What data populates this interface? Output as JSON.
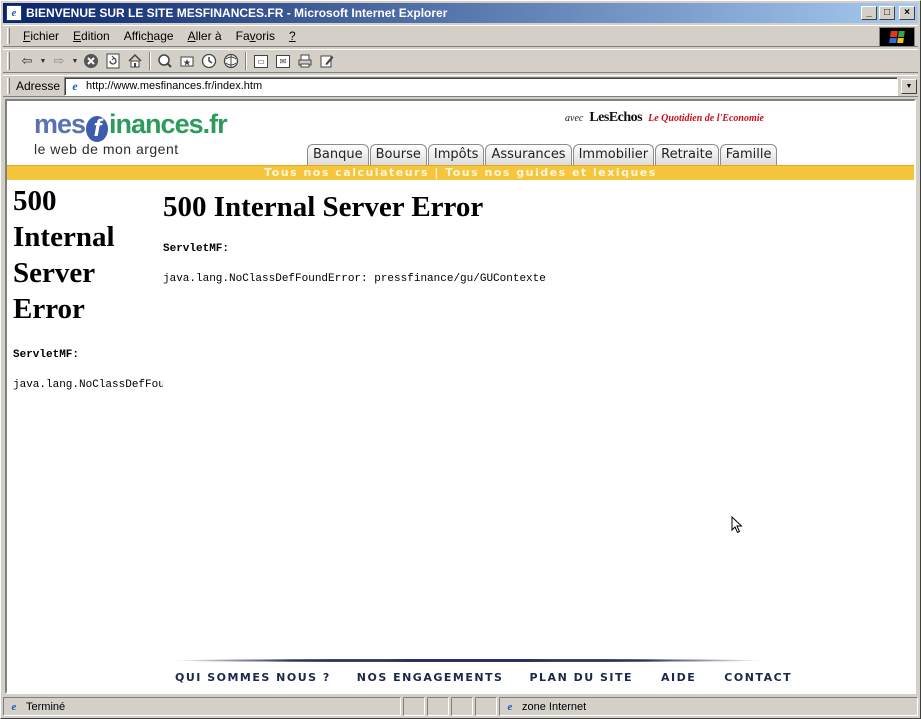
{
  "window": {
    "title": "BIENVENUE SUR LE SITE MESFINANCES.FR - Microsoft Internet Explorer",
    "controls": {
      "minimize": "_",
      "maximize": "□",
      "close": "×"
    }
  },
  "menubar": {
    "items": [
      {
        "label": "Fichier",
        "key": "F"
      },
      {
        "label": "Edition",
        "key": "E"
      },
      {
        "label": "Affichage",
        "key": "h"
      },
      {
        "label": "Aller à",
        "key": "A"
      },
      {
        "label": "Favoris",
        "key": "v"
      },
      {
        "label": "?",
        "key": "?"
      }
    ]
  },
  "toolbar": {
    "buttons": [
      "back-icon",
      "forward-icon",
      "stop-icon",
      "refresh-icon",
      "home-icon",
      "search-icon",
      "favorites-icon",
      "history-icon",
      "channels-icon",
      "fullscreen-icon",
      "mail-icon",
      "print-icon",
      "edit-icon"
    ]
  },
  "address": {
    "label": "Adresse",
    "url": "http://www.mesfinances.fr/index.htm"
  },
  "site": {
    "logo": {
      "part1": "mes",
      "part2": "f",
      "part3": "inances",
      "part4": ".fr",
      "tagline": "le web de mon argent"
    },
    "partner": {
      "avec": "avec",
      "echos": "LesEchos",
      "quotidien": "Le Quotidien de l'Economie"
    },
    "tabs": [
      "Banque",
      "Bourse",
      "Impôts",
      "Assurances",
      "Immobilier",
      "Retraite",
      "Famille"
    ],
    "band_text": "Tous nos calculateurs | Tous nos guides et lexiques"
  },
  "error_left": {
    "title": "500 Internal Server Error",
    "servlet": "ServletMF:",
    "message": "java.lang.NoClassDefFoundError: pressfinance/gu/GUContexte"
  },
  "error_main": {
    "title": "500 Internal Server Error",
    "servlet": "ServletMF:",
    "message": "java.lang.NoClassDefFoundError: pressfinance/gu/GUContexte"
  },
  "footer": {
    "links": [
      "QUI SOMMES NOUS ?",
      "NOS ENGAGEMENTS",
      "PLAN DU SITE",
      "AIDE",
      "CONTACT"
    ]
  },
  "statusbar": {
    "status": "Terminé",
    "zone": "zone Internet"
  }
}
